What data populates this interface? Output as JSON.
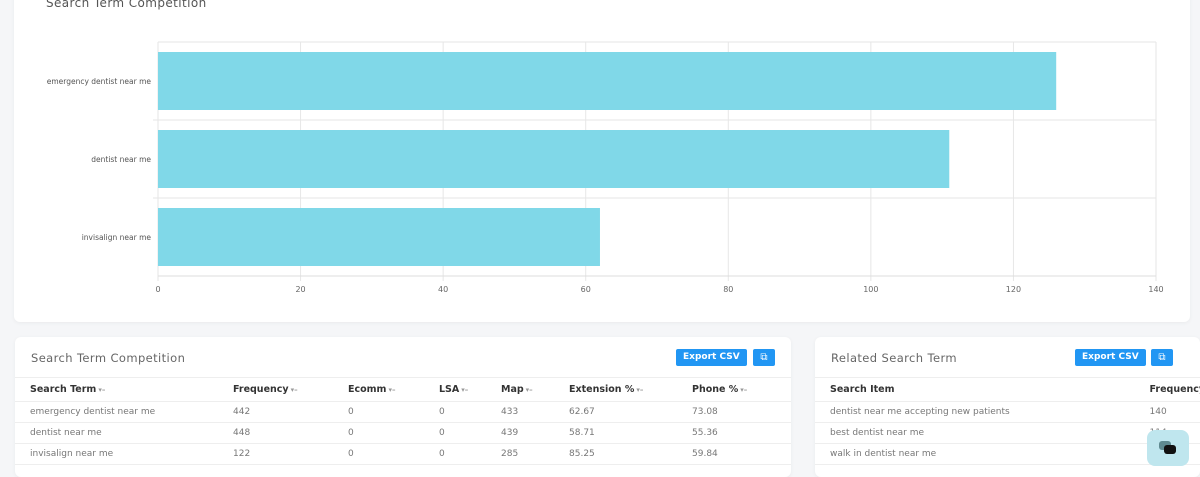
{
  "chart": {
    "title": "Search Term Competition"
  },
  "chart_data": {
    "type": "bar",
    "orientation": "horizontal",
    "title": "Search Term Competition",
    "categories": [
      "emergency dentist near me",
      "dentist near me",
      "invisalign near me"
    ],
    "values": [
      126,
      111,
      62
    ],
    "xlim": [
      0,
      140
    ],
    "xticks": [
      0,
      20,
      40,
      60,
      80,
      100,
      120,
      140
    ],
    "color": "#80d8e8",
    "grid": true
  },
  "competition": {
    "title": "Search Term Competition",
    "export_label": "Export CSV",
    "columns": [
      "Search Term",
      "Frequency",
      "Ecomm",
      "LSA",
      "Map",
      "Extension %",
      "Phone %"
    ],
    "sort_icon": "sort-icon",
    "rows": [
      [
        "emergency dentist near me",
        "442",
        "0",
        "0",
        "433",
        "62.67",
        "73.08"
      ],
      [
        "dentist near me",
        "448",
        "0",
        "0",
        "439",
        "58.71",
        "55.36"
      ],
      [
        "invisalign near me",
        "122",
        "0",
        "0",
        "285",
        "85.25",
        "59.84"
      ]
    ]
  },
  "related": {
    "title": "Related Search Term",
    "export_label": "Export CSV",
    "columns": [
      "Search Item",
      "Frequency"
    ],
    "rows": [
      [
        "dentist near me accepting new patients",
        "140"
      ],
      [
        "best dentist near me",
        "114"
      ],
      [
        "walk in dentist near me",
        ""
      ]
    ]
  }
}
